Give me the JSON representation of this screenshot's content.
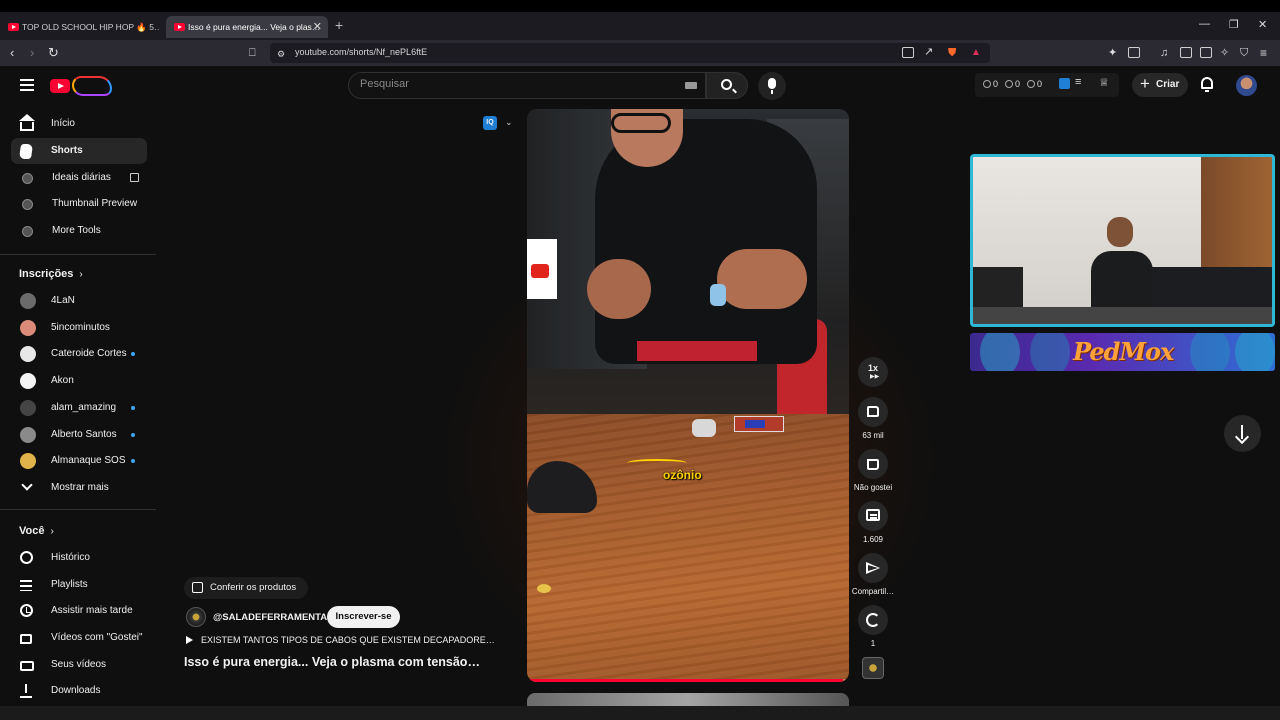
{
  "browser": {
    "tabs": [
      {
        "label": "TOP OLD SCHOOL HIP HOP 🔥 5…",
        "active": false
      },
      {
        "label": "Isso é pura energia... Veja o plas…",
        "active": true
      }
    ],
    "url": "youtube.com/shorts/Nf_nePL6ftE"
  },
  "header": {
    "search_placeholder": "Pesquisar",
    "counters": [
      "0",
      "0",
      "0"
    ],
    "create_label": "Criar"
  },
  "sidebar": {
    "main": [
      {
        "label": "Início",
        "icon": "home-icon",
        "active": false
      },
      {
        "label": "Shorts",
        "icon": "shorts-icon",
        "active": true
      },
      {
        "label": "Ideais diárias",
        "icon": "extension-icon",
        "active": false
      },
      {
        "label": "Thumbnail Preview",
        "icon": "extension-icon",
        "active": false
      },
      {
        "label": "More Tools",
        "icon": "extension-icon",
        "active": false
      }
    ],
    "subscriptions_title": "Inscrições",
    "subscriptions": [
      {
        "label": "4LaN",
        "new": false,
        "color": "#6b6b6b"
      },
      {
        "label": "5incominutos",
        "new": false,
        "color": "#d98c7a"
      },
      {
        "label": "Cateroide Cortes",
        "new": true,
        "color": "#e8e8e8"
      },
      {
        "label": "Akon",
        "new": false,
        "color": "#f4f4f4"
      },
      {
        "label": "alam_amazing",
        "new": true,
        "color": "#444444"
      },
      {
        "label": "Alberto Santos",
        "new": true,
        "color": "#8a8a8a"
      },
      {
        "label": "Almanaque SOS",
        "new": true,
        "color": "#e0b44a"
      }
    ],
    "show_more": "Mostrar mais",
    "you_title": "Você",
    "you": [
      {
        "label": "Histórico",
        "icon": "history-icon"
      },
      {
        "label": "Playlists",
        "icon": "playlists-icon"
      },
      {
        "label": "Assistir mais tarde",
        "icon": "watch-later-icon"
      },
      {
        "label": "Vídeos com \"Gostei\"",
        "icon": "liked-icon"
      },
      {
        "label": "Seus vídeos",
        "icon": "your-videos-icon"
      },
      {
        "label": "Downloads",
        "icon": "download-icon"
      }
    ]
  },
  "short": {
    "caption": "ozônio",
    "shop_label": "Conferir os produtos",
    "channel": "@SALADEFERRAMENTAS",
    "subscribe_label": "Inscrever-se",
    "description": "EXISTEM TANTOS TIPOS DE CABOS QUE EXISTEM DECAPADORE…",
    "title": "Isso é pura energia... Veja o plasma com tensão…",
    "speed": "1x",
    "likes": "63 mil",
    "dislike_label": "Não gostei",
    "comments": "1.609",
    "share_label": "Compartil…",
    "remix_count": "1",
    "progress": 0.98
  },
  "overlay": {
    "banner_text": "PedMox"
  },
  "colors": {
    "accent": "#ff0033",
    "webcam_border": "#2eb8d6",
    "caption": "#ffd400",
    "new_dot": "#3ea6ff"
  }
}
